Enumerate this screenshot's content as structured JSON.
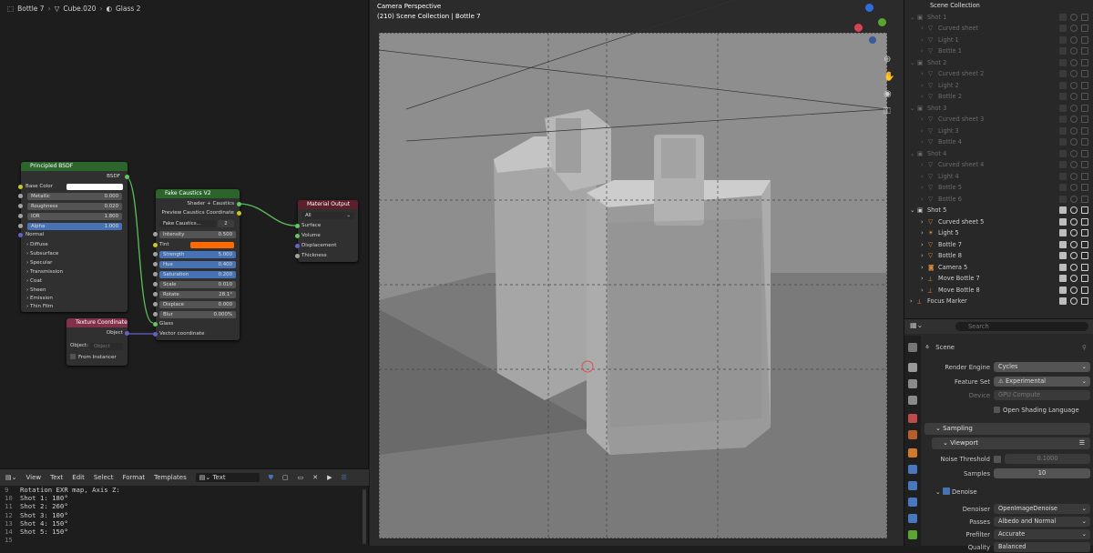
{
  "node_editor": {
    "breadcrumb": {
      "object": "Bottle 7",
      "mesh": "Cube.020",
      "material": "Glass 2"
    },
    "principled": {
      "title": "Principled BSDF",
      "output": "BSDF",
      "base_color": "Base Color",
      "fields": [
        {
          "label": "Metallic",
          "value": "0.000"
        },
        {
          "label": "Roughness",
          "value": "0.020"
        },
        {
          "label": "IOR",
          "value": "1.800"
        },
        {
          "label": "Alpha",
          "value": "1.000"
        }
      ],
      "normal": "Normal",
      "subpanels": [
        "Diffuse",
        "Subsurface",
        "Specular",
        "Transmission",
        "Coat",
        "Sheen",
        "Emission",
        "Thin Film"
      ]
    },
    "caustics": {
      "title": "Fake Caustics V2",
      "outputs": [
        "Shader + Caustics",
        "Preview Caustics Coordinate"
      ],
      "group_name": "Fake Caustics...",
      "users": "2",
      "fields": [
        {
          "label": "Intensity",
          "value": "0.500"
        },
        {
          "label": "Tint",
          "value": ""
        },
        {
          "label": "Strength",
          "value": "5.000"
        },
        {
          "label": "Hue",
          "value": "0.400"
        },
        {
          "label": "Saturation",
          "value": "0.200"
        },
        {
          "label": "Scale",
          "value": "0.010"
        },
        {
          "label": "Rotate",
          "value": "28.1°"
        },
        {
          "label": "Displace",
          "value": "0.000"
        },
        {
          "label": "Blur",
          "value": "0.000%"
        }
      ],
      "inputs": [
        "Glass",
        "Vector coordinate"
      ]
    },
    "material_output": {
      "title": "Material Output",
      "target": "All",
      "inputs": [
        "Surface",
        "Volume",
        "Displacement",
        "Thickness"
      ]
    },
    "texcoord": {
      "title": "Texture Coordinate",
      "output": "Object",
      "object_label": "Object:",
      "object_placeholder": "Object",
      "from_instancer": "From Instancer"
    }
  },
  "text_editor": {
    "menu": [
      "View",
      "Text",
      "Edit",
      "Select",
      "Format",
      "Templates"
    ],
    "text_name": "Text",
    "lines": [
      {
        "n": "9",
        "t": "Rotation EXR map, Axis Z:"
      },
      {
        "n": "10",
        "t": "Shot 1: 180°"
      },
      {
        "n": "11",
        "t": "Shot 2: 260°"
      },
      {
        "n": "12",
        "t": "Shot 3: 100°"
      },
      {
        "n": "13",
        "t": "Shot 4: 150°"
      },
      {
        "n": "14",
        "t": "Shot 5: 150°"
      },
      {
        "n": "15",
        "t": ""
      }
    ]
  },
  "viewport": {
    "mode": "Camera Perspective",
    "path": "(210) Scene Collection | Bottle 7"
  },
  "outliner": {
    "title": "Scene Collection",
    "rows": [
      {
        "label": "Shot 1",
        "dim": true,
        "kind": "collection",
        "indent": 1
      },
      {
        "label": "Curved sheet",
        "dim": true,
        "kind": "mesh",
        "indent": 2
      },
      {
        "label": "Light 1",
        "dim": true,
        "kind": "mesh",
        "indent": 2
      },
      {
        "label": "Bottle 1",
        "dim": true,
        "kind": "mesh",
        "indent": 2
      },
      {
        "label": "Shot 2",
        "dim": true,
        "kind": "collection",
        "indent": 1
      },
      {
        "label": "Curved sheet 2",
        "dim": true,
        "kind": "mesh",
        "indent": 2
      },
      {
        "label": "Light 2",
        "dim": true,
        "kind": "mesh",
        "indent": 2
      },
      {
        "label": "Bottle 2",
        "dim": true,
        "kind": "mesh",
        "indent": 2
      },
      {
        "label": "Shot 3",
        "dim": true,
        "kind": "collection",
        "indent": 1
      },
      {
        "label": "Curved sheet 3",
        "dim": true,
        "kind": "mesh",
        "indent": 2
      },
      {
        "label": "Light 3",
        "dim": true,
        "kind": "mesh",
        "indent": 2
      },
      {
        "label": "Bottle 4",
        "dim": true,
        "kind": "mesh",
        "indent": 2
      },
      {
        "label": "Shot 4",
        "dim": true,
        "kind": "collection",
        "indent": 1
      },
      {
        "label": "Curved sheet 4",
        "dim": true,
        "kind": "mesh",
        "indent": 2
      },
      {
        "label": "Light 4",
        "dim": true,
        "kind": "mesh",
        "indent": 2
      },
      {
        "label": "Bottle 5",
        "dim": true,
        "kind": "mesh",
        "indent": 2
      },
      {
        "label": "Bottle 6",
        "dim": true,
        "kind": "mesh",
        "indent": 2
      },
      {
        "label": "Shot 5",
        "dim": false,
        "kind": "collection",
        "indent": 1
      },
      {
        "label": "Curved sheet 5",
        "dim": false,
        "kind": "mesh",
        "indent": 2
      },
      {
        "label": "Light 5",
        "dim": false,
        "kind": "light",
        "indent": 2
      },
      {
        "label": "Bottle 7",
        "dim": false,
        "kind": "mesh",
        "indent": 2
      },
      {
        "label": "Bottle 8",
        "dim": false,
        "kind": "mesh",
        "indent": 2
      },
      {
        "label": "Camera 5",
        "dim": false,
        "kind": "camera",
        "indent": 2
      },
      {
        "label": "Move Bottle 7",
        "dim": false,
        "kind": "empty",
        "indent": 2
      },
      {
        "label": "Move Bottle 8",
        "dim": false,
        "kind": "empty",
        "indent": 2
      },
      {
        "label": "Focus Marker",
        "dim": false,
        "kind": "empty",
        "indent": 1
      }
    ]
  },
  "properties": {
    "search_placeholder": "Search",
    "context": "Scene",
    "rows": [
      {
        "label": "Render Engine",
        "value": "Cycles"
      },
      {
        "label": "Feature Set",
        "value": "Experimental"
      },
      {
        "label": "Device",
        "value": "GPU Compute"
      }
    ],
    "open_shading": "Open Shading Language",
    "sampling": "Sampling",
    "viewport": "Viewport",
    "noise_threshold": {
      "label": "Noise Threshold",
      "value": "0.1000"
    },
    "samples": {
      "label": "Samples",
      "value": "10"
    },
    "denoise": "Denoise",
    "denoise_rows": [
      {
        "label": "Denoiser",
        "value": "OpenImageDenoise"
      },
      {
        "label": "Passes",
        "value": "Albedo and Normal"
      },
      {
        "label": "Prefilter",
        "value": "Accurate"
      },
      {
        "label": "Quality",
        "value": "Balanced"
      }
    ]
  },
  "colors": {
    "tint": "#ff6a00",
    "accent": "#4772b3",
    "shader_header": "#2b652b",
    "input_header": "#83314a",
    "output_header": "#5c1f2c"
  }
}
